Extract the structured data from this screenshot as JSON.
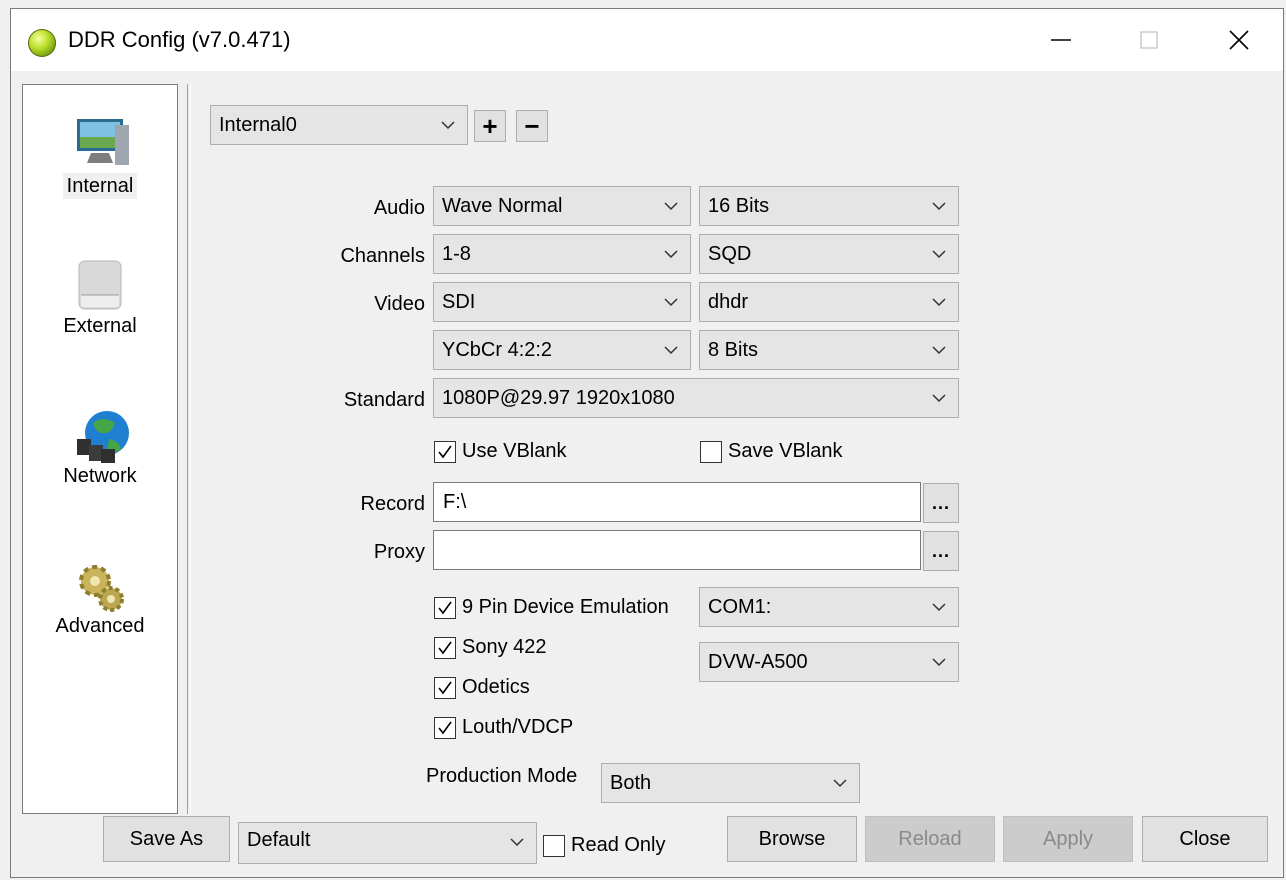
{
  "window": {
    "title": "DDR Config (v7.0.471)"
  },
  "nav": {
    "items": [
      {
        "label": "Internal",
        "icon": "monitor-icon",
        "selected": true
      },
      {
        "label": "External",
        "icon": "drive-icon",
        "selected": false
      },
      {
        "label": "Network",
        "icon": "network-globe-icon",
        "selected": false
      },
      {
        "label": "Advanced",
        "icon": "gears-icon",
        "selected": false
      }
    ]
  },
  "device": {
    "selected": "Internal0",
    "add_label": "+",
    "remove_label": "−"
  },
  "form": {
    "audio": {
      "label": "Audio",
      "format": "Wave Normal",
      "bits": "16 Bits"
    },
    "channels": {
      "label": "Channels",
      "range": "1-8",
      "mode": "SQD"
    },
    "video": {
      "label": "Video",
      "input": "SDI",
      "codec": "dhdr",
      "color": "YCbCr 4:2:2",
      "bits": "8 Bits"
    },
    "standard": {
      "label": "Standard",
      "value": "1080P@29.97 1920x1080"
    },
    "use_vblank": {
      "label": "Use VBlank",
      "checked": true
    },
    "save_vblank": {
      "label": "Save VBlank",
      "checked": false
    },
    "record": {
      "label": "Record",
      "value": "F:\\",
      "browse": "..."
    },
    "proxy": {
      "label": "Proxy",
      "value": "",
      "browse": "..."
    },
    "nine_pin": {
      "label": "9 Pin Device Emulation",
      "checked": true
    },
    "sony422": {
      "label": "Sony 422",
      "checked": true
    },
    "odetics": {
      "label": "Odetics",
      "checked": true
    },
    "louth": {
      "label": "Louth/VDCP",
      "checked": true
    },
    "com_port": "COM1:",
    "device_model": "DVW-A500",
    "production_mode": {
      "label": "Production Mode",
      "value": "Both"
    }
  },
  "footer": {
    "save_as": "Save As",
    "preset": "Default",
    "read_only": {
      "label": "Read Only",
      "checked": false
    },
    "browse": "Browse",
    "reload": "Reload",
    "apply": "Apply",
    "close": "Close"
  }
}
